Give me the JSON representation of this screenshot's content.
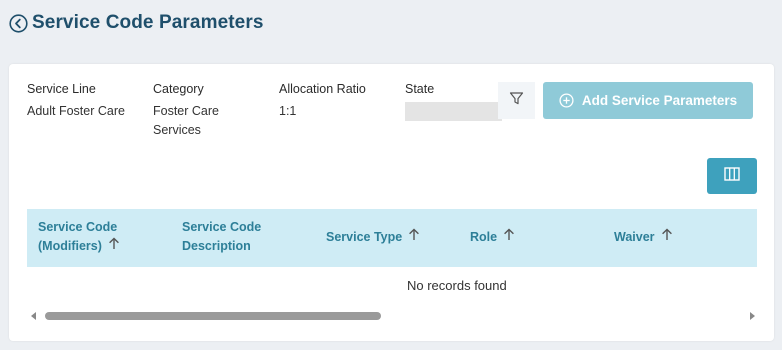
{
  "header": {
    "title": "Service Code Parameters"
  },
  "details": {
    "service_line": {
      "label": "Service Line",
      "value": "Adult Foster Care"
    },
    "category": {
      "label": "Category",
      "value": "Foster Care Services"
    },
    "allocation_ratio": {
      "label": "Allocation Ratio",
      "value": "1:1"
    },
    "state": {
      "label": "State",
      "value": ""
    }
  },
  "toolbar": {
    "add_label": "Add Service Parameters"
  },
  "table": {
    "columns": [
      {
        "line1": "Service Code",
        "line2": "(Modifiers)"
      },
      {
        "line1": "Service Code",
        "line2": "Description"
      },
      {
        "line1": "Service Type"
      },
      {
        "line1": "Role"
      },
      {
        "line1": "Waiver"
      }
    ],
    "empty_message": "No records found"
  },
  "colors": {
    "title": "#1f4f6b",
    "header_bg": "#cfecf5",
    "header_text": "#2d7f98",
    "primary_button": "#3ea1bd",
    "disabled_button": "#8fcad8"
  }
}
